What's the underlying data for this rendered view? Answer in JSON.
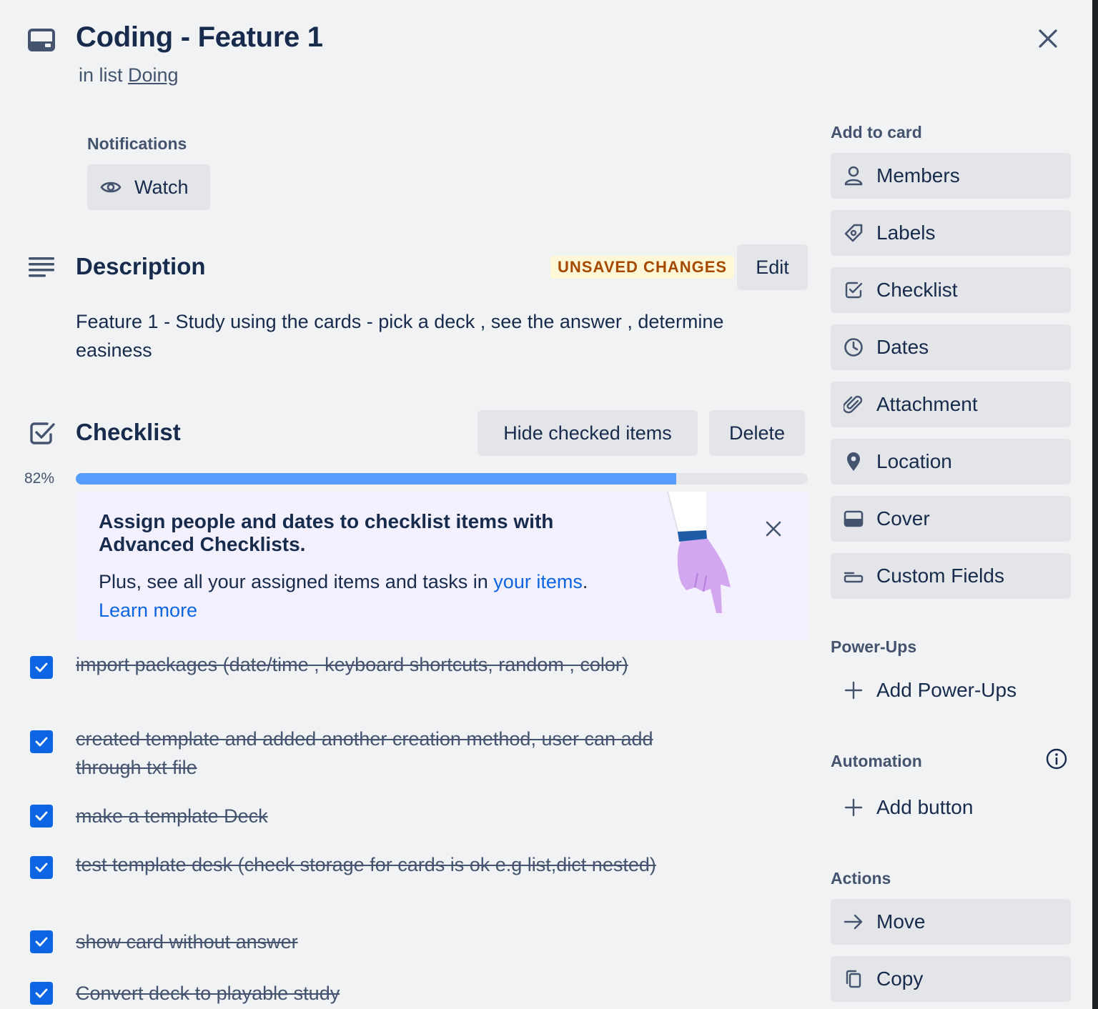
{
  "card": {
    "title": "Coding - Feature 1",
    "in_list_prefix": "in list",
    "list_name": "Doing"
  },
  "notifications": {
    "label": "Notifications",
    "watch_label": "Watch"
  },
  "description": {
    "heading": "Description",
    "badge": "UNSAVED CHANGES",
    "edit_label": "Edit",
    "text": "Feature 1 - Study using the cards - pick a deck , see the answer , determine easiness"
  },
  "checklist": {
    "heading": "Checklist",
    "hide_label": "Hide checked items",
    "delete_label": "Delete",
    "progress_text": "82%",
    "progress": 0.82,
    "promo": {
      "heading": "Assign people and dates to checklist items with Advanced Checklists.",
      "body_prefix": "Plus, see all your assigned items and tasks in",
      "body_link": "your items",
      "body_suffix": ".",
      "learn_more": "Learn more"
    },
    "items": [
      {
        "text": "import packages (date/time , keyboard shortcuts, random , color)",
        "checked": true
      },
      {
        "text": "created template and added another creation method, user can add through txt file",
        "checked": true
      },
      {
        "text": "make a template Deck",
        "checked": true
      },
      {
        "text": "test template desk (check storage for cards is ok e.g list,dict nested)",
        "checked": true
      },
      {
        "text": "show card without answer",
        "checked": true
      },
      {
        "text": "Convert deck to playable study",
        "checked": true
      }
    ]
  },
  "sidebar": {
    "add_to_card": "Add to card",
    "buttons": [
      {
        "label": "Members",
        "icon": "person-icon"
      },
      {
        "label": "Labels",
        "icon": "tag-icon"
      },
      {
        "label": "Checklist",
        "icon": "checkbox-icon"
      },
      {
        "label": "Dates",
        "icon": "clock-icon"
      },
      {
        "label": "Attachment",
        "icon": "paperclip-icon"
      },
      {
        "label": "Location",
        "icon": "pin-icon"
      },
      {
        "label": "Cover",
        "icon": "cover-icon"
      },
      {
        "label": "Custom Fields",
        "icon": "fields-icon"
      }
    ],
    "powerups_label": "Power-Ups",
    "add_powerups": "Add Power-Ups",
    "automation_label": "Automation",
    "add_button": "Add button",
    "actions_label": "Actions",
    "actions": [
      {
        "label": "Move",
        "icon": "arrow-right-icon"
      },
      {
        "label": "Copy",
        "icon": "copy-icon"
      }
    ]
  },
  "colors": {
    "accent": "#0c66e4",
    "progress": "#579dff",
    "badge_bg": "#fff7d6",
    "badge_text": "#a54800"
  }
}
